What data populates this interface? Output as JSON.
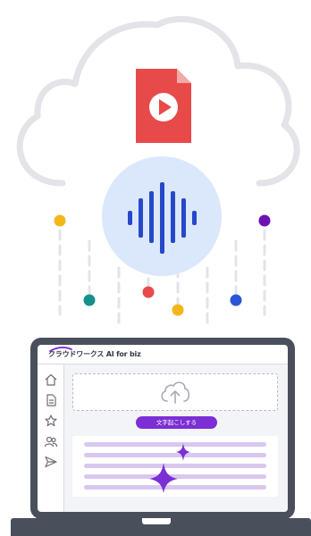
{
  "app": {
    "brand_name": "クラウドワークス AI for biz",
    "transcribe_button_label": "文字起こしする"
  },
  "icons": {
    "file": "video-file-icon",
    "audio": "audio-wave-icon",
    "upload": "upload-icon",
    "sidebar": [
      "home-icon",
      "document-icon",
      "star-icon",
      "users-icon",
      "send-icon"
    ],
    "sparkle": "sparkle-icon"
  },
  "colors": {
    "accent": "#7b2fd4",
    "file_red": "#e84a4a",
    "audio_blue": "#2748c8",
    "audio_circle": "#dbe8fb",
    "dots": [
      "#f2b81a",
      "#178f8a",
      "#e84a4a",
      "#f2b81a",
      "#2a56d6",
      "#6b12b5"
    ]
  }
}
